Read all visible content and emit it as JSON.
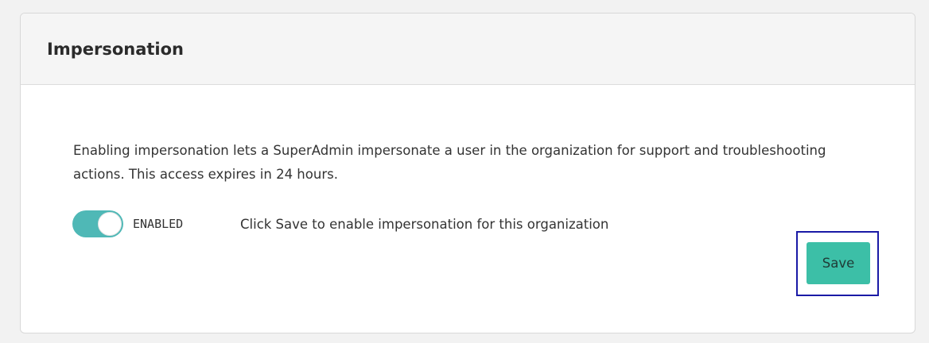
{
  "card": {
    "title": "Impersonation"
  },
  "description": "Enabling impersonation lets a SuperAdmin impersonate a user in the organization for support and troubleshooting actions. This access expires in 24 hours.",
  "toggle": {
    "state_label": "ENABLED",
    "enabled": true,
    "accent_color": "#4fb8b6"
  },
  "hint": "Click Save to enable impersonation for this organization",
  "actions": {
    "save_label": "Save",
    "save_color": "#3cbfa7",
    "highlight_color": "#1a1aa6"
  }
}
